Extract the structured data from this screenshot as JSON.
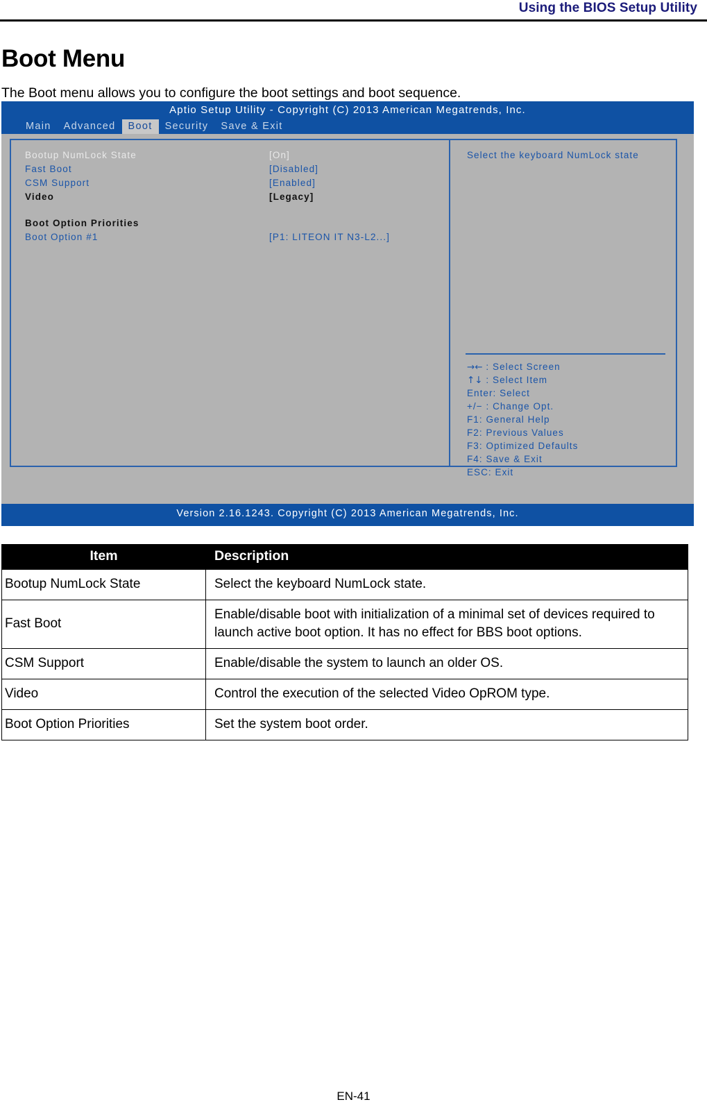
{
  "page": {
    "running_header": "Using the BIOS Setup Utility",
    "section_title": "Boot Menu",
    "section_intro": "The Boot menu allows you to configure the boot settings and boot sequence.",
    "page_number": "EN-41"
  },
  "bios": {
    "title": "Aptio Setup Utility - Copyright (C) 2013 American Megatrends, Inc.",
    "footer": "Version 2.16.1243. Copyright (C) 2013 American Megatrends, Inc.",
    "menu": [
      {
        "label": "Main",
        "active": false
      },
      {
        "label": "Advanced",
        "active": false
      },
      {
        "label": "Boot",
        "active": true
      },
      {
        "label": "Security",
        "active": false
      },
      {
        "label": "Save & Exit",
        "active": false
      }
    ],
    "settings": [
      {
        "label": "Bootup NumLock State",
        "value": "[On]",
        "style": "selected"
      },
      {
        "label": "Fast Boot",
        "value": "[Disabled]",
        "style": "blue"
      },
      {
        "label": "CSM Support",
        "value": "[Enabled]",
        "style": "blue"
      },
      {
        "label": "Video",
        "value": "[Legacy]",
        "style": "dark"
      }
    ],
    "boot_priorities_heading": "Boot Option Priorities",
    "boot_options": [
      {
        "label": "Boot Option #1",
        "value": "[P1: LITEON IT N3-L2...]",
        "style": "blue"
      }
    ],
    "help_text": "Select the keyboard NumLock state",
    "keys": [
      {
        "glyph": "→←",
        "text": " : Select Screen"
      },
      {
        "glyph": "↑↓",
        "text": " : Select Item"
      },
      {
        "glyph": "",
        "text": "Enter: Select"
      },
      {
        "glyph": "",
        "text": "+/− : Change Opt."
      },
      {
        "glyph": "",
        "text": "F1: General Help"
      },
      {
        "glyph": "",
        "text": "F2: Previous Values"
      },
      {
        "glyph": "",
        "text": "F3: Optimized Defaults"
      },
      {
        "glyph": "",
        "text": "F4: Save & Exit"
      },
      {
        "glyph": "",
        "text": "ESC: Exit"
      }
    ],
    "colors": {
      "titlebar_blue": "#0f51a3",
      "panel_gray": "#b3b3b3",
      "text_blue": "#1a54a8",
      "border_blue": "#2a62ad"
    }
  },
  "table": {
    "headers": {
      "item": "Item",
      "description": "Description"
    },
    "rows": [
      {
        "item": "Bootup NumLock State",
        "description": "Select the keyboard NumLock state."
      },
      {
        "item": "Fast Boot",
        "description": "Enable/disable boot with initialization of a minimal set of devices required to launch active boot option. It has no effect for BBS boot options."
      },
      {
        "item": "CSM Support",
        "description": "Enable/disable the system to launch an older OS."
      },
      {
        "item": "Video",
        "description": "Control the execution of the selected Video OpROM type."
      },
      {
        "item": "Boot Option Priorities",
        "description": "Set the system boot order."
      }
    ]
  }
}
